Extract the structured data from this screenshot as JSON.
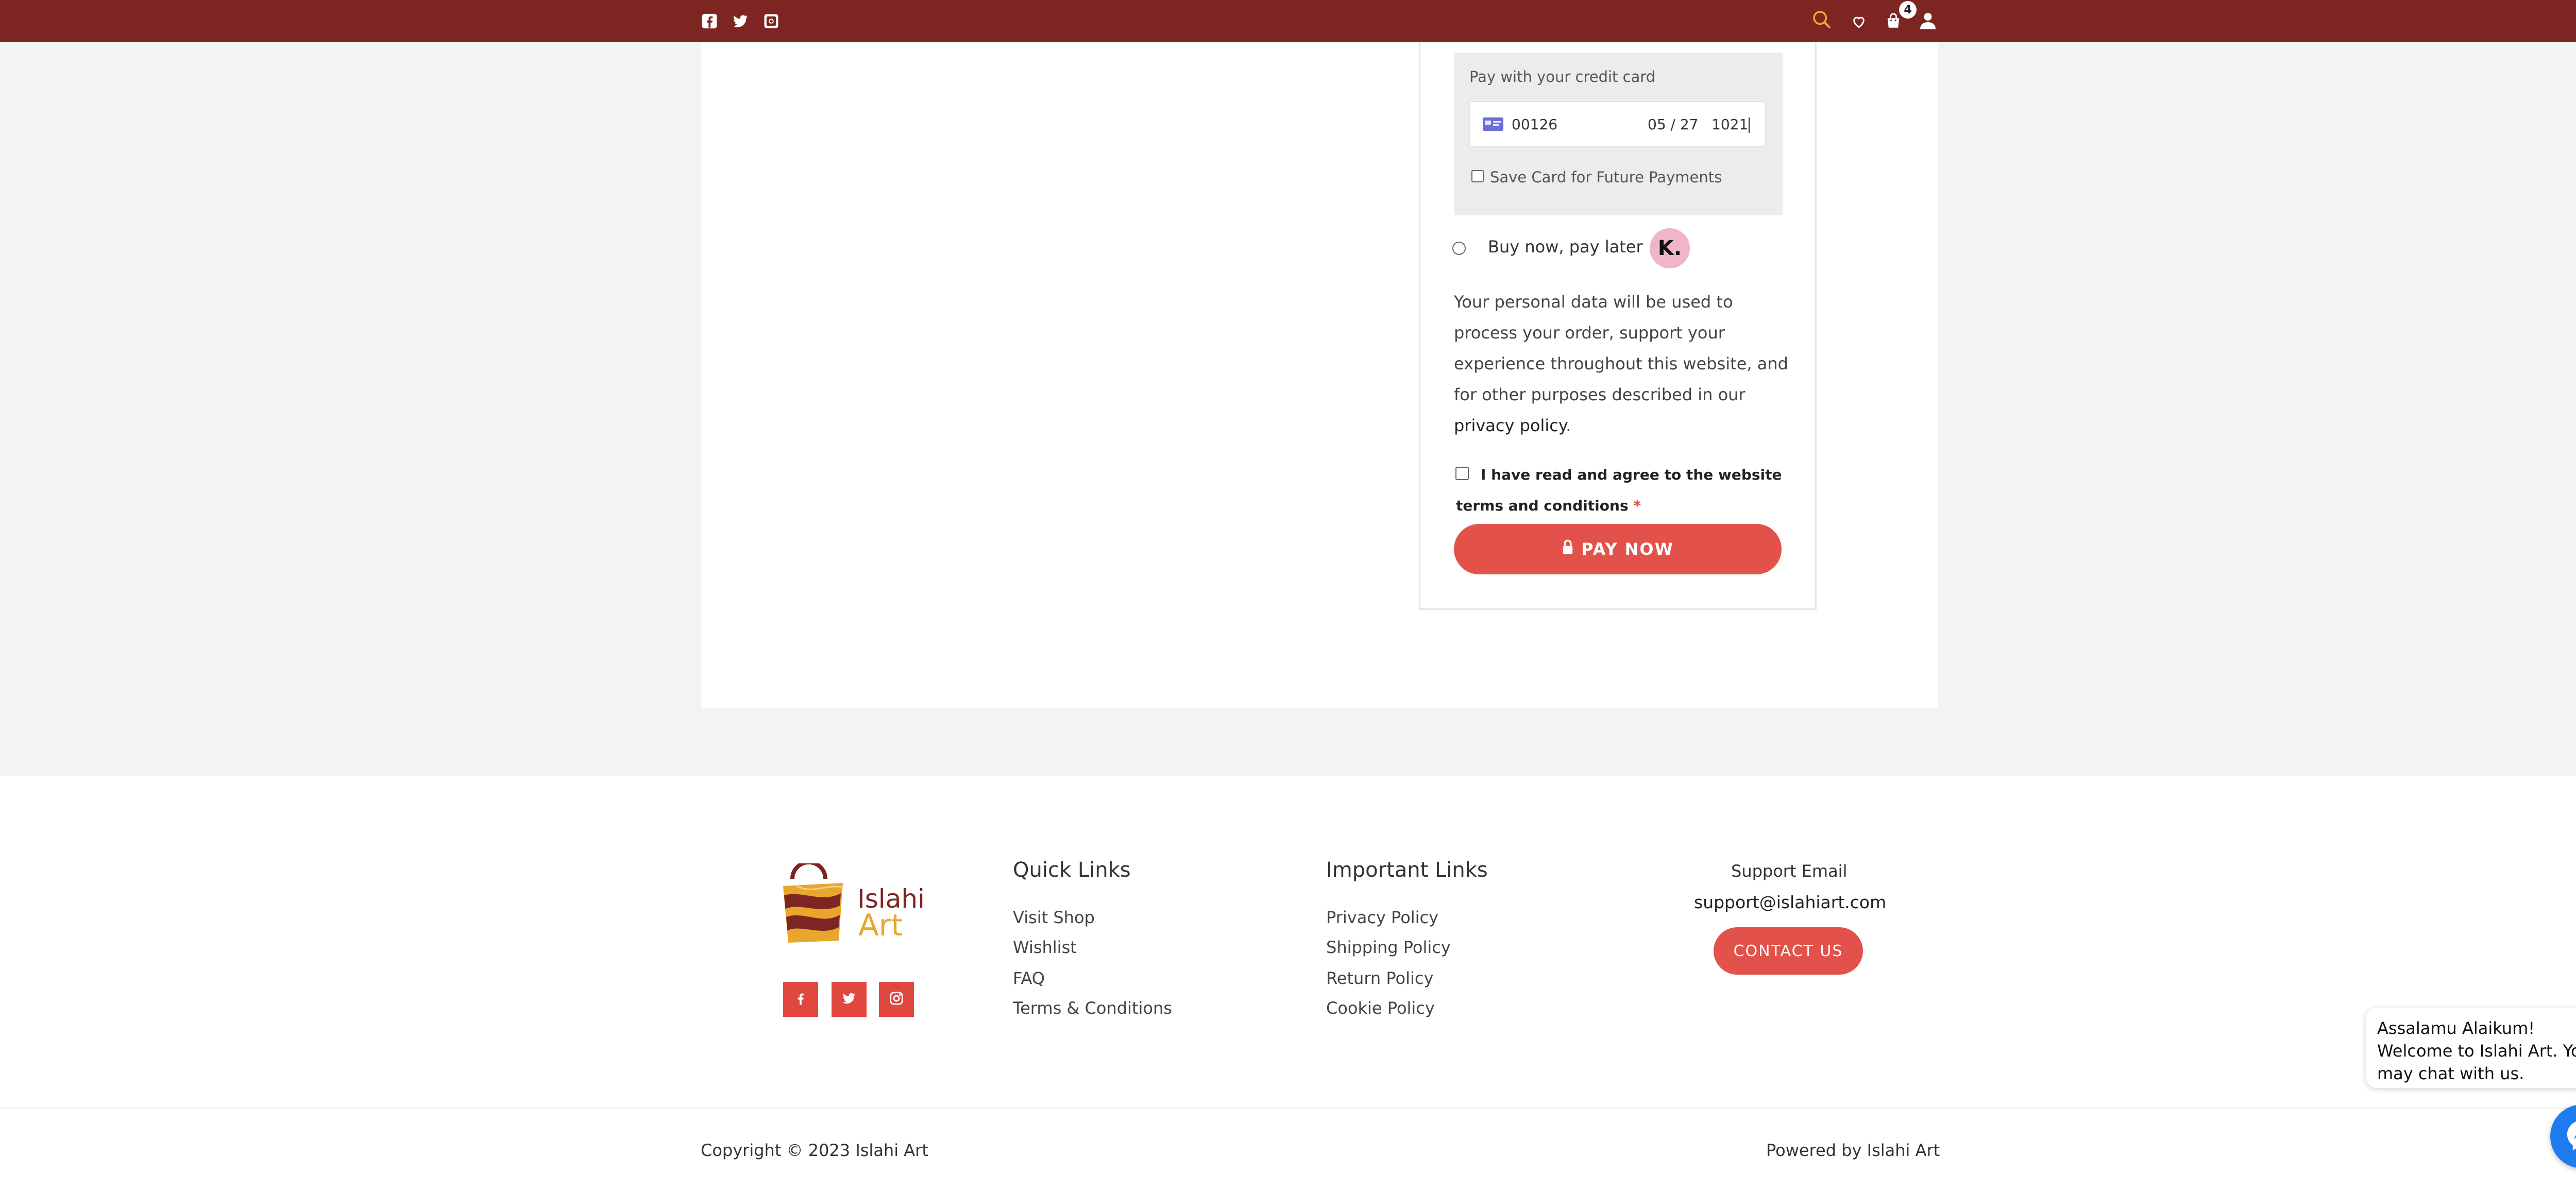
{
  "topbar": {
    "social_icons": [
      "facebook-icon",
      "twitter-icon",
      "instagram-icon"
    ],
    "right_icons": [
      "search-icon",
      "heart-icon",
      "cart-icon",
      "user-icon"
    ],
    "cart_count": "4",
    "colors": {
      "bar": "#7d2523",
      "search_icon": "#e8a72c"
    }
  },
  "payment": {
    "card_title": "Pay with your credit card",
    "card_number": "00126",
    "card_expiry": "05 / 27",
    "card_cvc": "1021",
    "save_card_label": "Save Card for Future Payments",
    "bnpl_label": "Buy now, pay later",
    "klarna_badge": "K.",
    "privacy_text": "Your personal data will be used to process your order, support your experience throughout this website, and for other purposes described in our ",
    "privacy_link": "privacy policy",
    "privacy_end": ".",
    "terms_label": "I have read and agree to the website terms and conditions",
    "required_mark": "*",
    "pay_button": "PAY NOW",
    "colors": {
      "accent": "#e2514a"
    }
  },
  "footer": {
    "logo_word1": "Islahi",
    "logo_word2": "Art",
    "social_icons": [
      "facebook-icon",
      "twitter-icon",
      "instagram-icon"
    ],
    "quick_links": {
      "title": "Quick Links",
      "items": [
        "Visit Shop",
        "Wishlist",
        "FAQ",
        "Terms & Conditions"
      ]
    },
    "important_links": {
      "title": "Important Links",
      "items": [
        "Privacy Policy",
        "Shipping Policy",
        "Return Policy",
        "Cookie Policy"
      ]
    },
    "support": {
      "title": "Support Email",
      "email": "support@islahiart.com",
      "button": "CONTACT US"
    },
    "copyright": "Copyright © 2023 Islahi Art",
    "powered_by": "Powered by Islahi Art"
  },
  "chat": {
    "close": "−",
    "message": "Assalamu Alaikum! Welcome to Islahi Art. You may chat with us.",
    "icon": "messenger-icon"
  }
}
